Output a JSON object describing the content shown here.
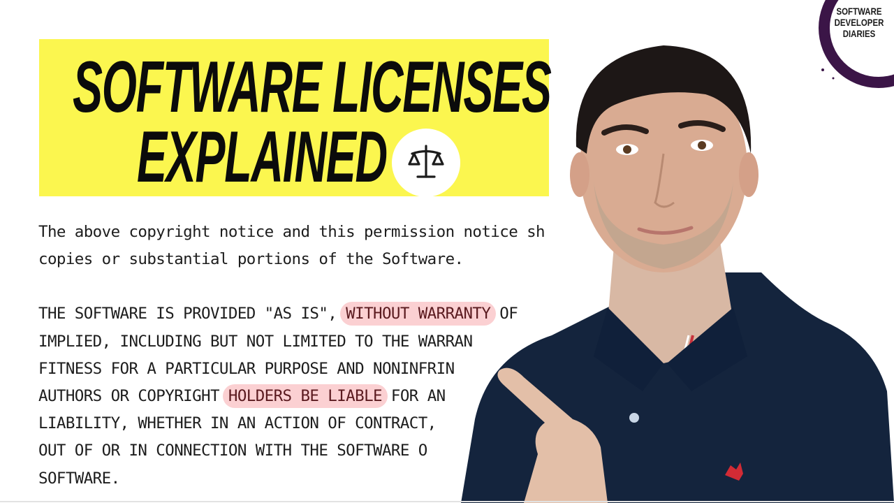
{
  "title": {
    "line1": "SOFTWARE LICENSES",
    "line2": "EXPLAINED",
    "badge_icon": "scales-of-justice-icon",
    "background_color": "#fbf64f"
  },
  "logo": {
    "lines": [
      "SOFTWARE",
      "DEVELOPER",
      "DIARIES"
    ],
    "ring_color": "#3b1547"
  },
  "license_text": {
    "paragraph1": [
      "The above copyright notice and this permission notice sh           d in all",
      "copies or substantial portions of the Software."
    ],
    "paragraph2": [
      {
        "before": "THE SOFTWARE IS PROVIDED \"AS IS\", ",
        "highlight": "WITHOUT WARRANTY",
        "after": " OF"
      },
      {
        "before": "IMPLIED, INCLUDING BUT NOT LIMITED TO THE WARRAN",
        "highlight": "",
        "after": ""
      },
      {
        "before": "FITNESS FOR A PARTICULAR PURPOSE AND NONINFRIN",
        "highlight": "",
        "after": ""
      },
      {
        "before": "AUTHORS OR COPYRIGHT ",
        "highlight": "HOLDERS BE LIABLE",
        "after": " FOR AN"
      },
      {
        "before": "LIABILITY, WHETHER IN AN ACTION OF CONTRACT,",
        "highlight": "",
        "after": ""
      },
      {
        "before": "OUT OF OR IN CONNECTION WITH THE SOFTWARE O",
        "highlight": "",
        "after": ""
      },
      {
        "before": "SOFTWARE.",
        "highlight": "",
        "after": ""
      }
    ],
    "highlight_color": "#fbd0d2"
  },
  "presenter": {
    "shirt_color": "#14243d",
    "description": "man in navy polo pointing at text"
  }
}
